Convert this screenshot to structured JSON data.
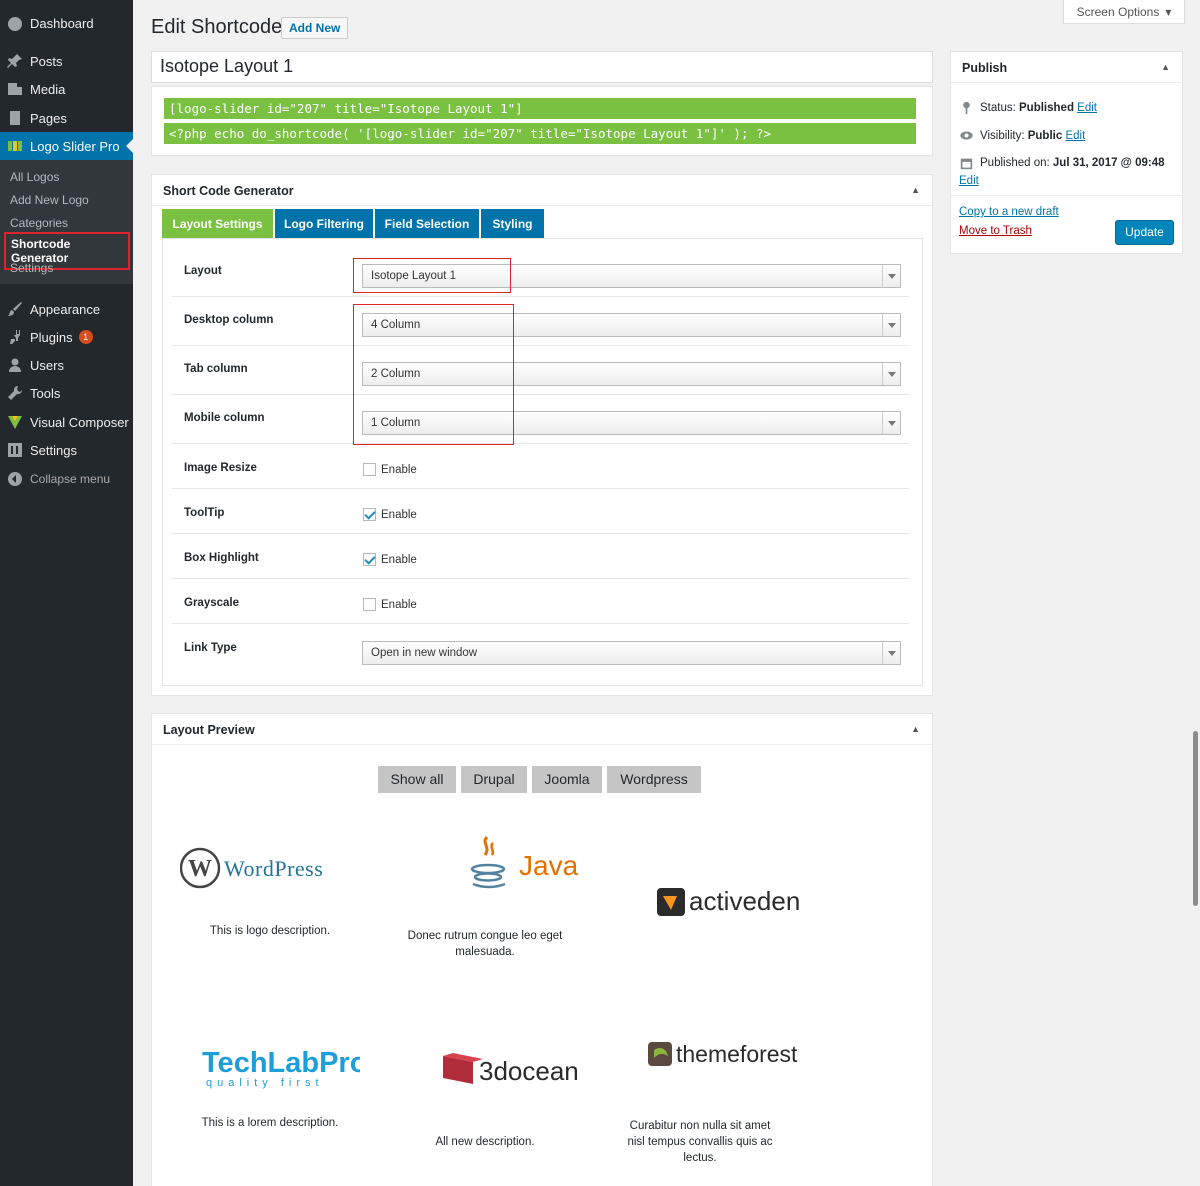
{
  "sidebar": {
    "items": [
      {
        "label": "Dashboard",
        "icon": "dashboard-icon"
      },
      {
        "label": "Posts",
        "icon": "pin-icon"
      },
      {
        "label": "Media",
        "icon": "media-icon"
      },
      {
        "label": "Pages",
        "icon": "pages-icon"
      },
      {
        "label": "Logo Slider Pro",
        "icon": "grid-icon"
      },
      {
        "label": "Appearance",
        "icon": "brush-icon"
      },
      {
        "label": "Plugins",
        "icon": "plug-icon",
        "badge": "1"
      },
      {
        "label": "Users",
        "icon": "user-icon"
      },
      {
        "label": "Tools",
        "icon": "wrench-icon"
      },
      {
        "label": "Visual Composer",
        "icon": "vc-icon"
      },
      {
        "label": "Settings",
        "icon": "settings-icon"
      }
    ],
    "submenu": [
      "All Logos",
      "Add New Logo",
      "Categories",
      "Shortcode Generator",
      "Settings"
    ],
    "collapse": "Collapse menu"
  },
  "header": {
    "title": "Edit Shortcode",
    "add_new": "Add New",
    "screen_options": "Screen Options"
  },
  "post_title": "Isotope Layout 1",
  "shortcodes": [
    "[logo-slider id=\"207\" title=\"Isotope Layout 1\"]",
    "<?php echo do_shortcode( '[logo-slider id=\"207\" title=\"Isotope Layout 1\"]' ); ?>"
  ],
  "generator": {
    "title": "Short Code Generator",
    "tabs": [
      "Layout Settings",
      "Logo Filtering",
      "Field Selection",
      "Styling"
    ],
    "rows": {
      "layout": {
        "label": "Layout",
        "value": "Isotope Layout 1"
      },
      "desktop": {
        "label": "Desktop column",
        "value": "4 Column"
      },
      "tab": {
        "label": "Tab column",
        "value": "2 Column"
      },
      "mobile": {
        "label": "Mobile column",
        "value": "1 Column"
      },
      "image_resize": {
        "label": "Image Resize",
        "option": "Enable",
        "checked": false
      },
      "tooltip": {
        "label": "ToolTip",
        "option": "Enable",
        "checked": true
      },
      "box_highlight": {
        "label": "Box Highlight",
        "option": "Enable",
        "checked": true
      },
      "grayscale": {
        "label": "Grayscale",
        "option": "Enable",
        "checked": false
      },
      "link_type": {
        "label": "Link Type",
        "value": "Open in new window"
      }
    }
  },
  "publish": {
    "title": "Publish",
    "status_label": "Status:",
    "status_value": "Published",
    "visibility_label": "Visibility:",
    "visibility_value": "Public",
    "published_label": "Published on:",
    "published_value": "Jul 31, 2017 @ 09:48",
    "edit": "Edit",
    "copy_draft": "Copy to a new draft",
    "trash": "Move to Trash",
    "update": "Update"
  },
  "preview": {
    "title": "Layout Preview",
    "filters": [
      "Show all",
      "Drupal",
      "Joomla",
      "Wordpress"
    ],
    "logos": [
      {
        "name": "WordPress",
        "desc": "This is logo description."
      },
      {
        "name": "Java",
        "desc": "Donec rutrum congue leo eget malesuada."
      },
      {
        "name": "activeden",
        "desc": ""
      },
      {
        "name": "TechLabPro",
        "tagline": "quality first",
        "desc": "This is a lorem description."
      },
      {
        "name": "3docean",
        "desc": "All new description."
      },
      {
        "name": "themeforest",
        "desc": "Curabitur non nulla sit amet nisl tempus convallis quis ac lectus."
      }
    ]
  }
}
